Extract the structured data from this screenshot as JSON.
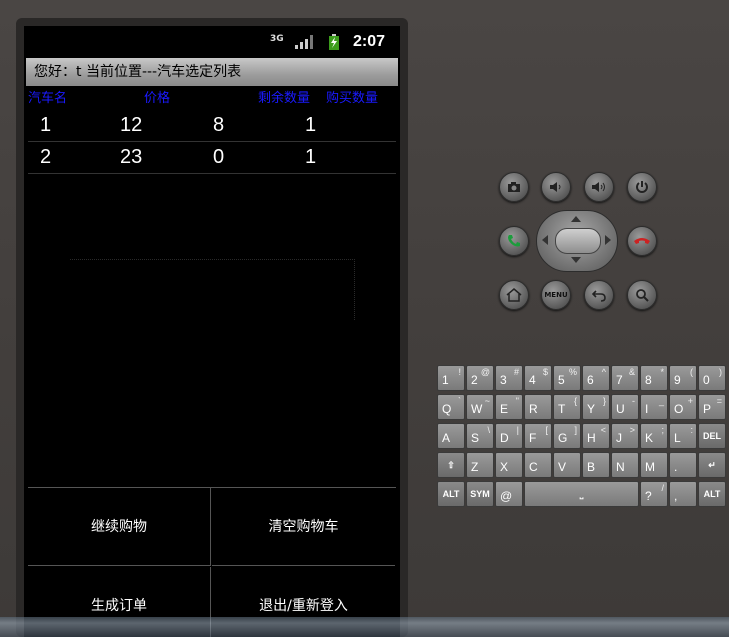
{
  "status": {
    "network": "3G",
    "time": "2:07"
  },
  "titlebar": {
    "text": "您好：t  当前位置---汽车选定列表"
  },
  "table": {
    "headers": [
      "汽车名",
      "价格",
      "剩余数量",
      "购买数量"
    ],
    "rows": [
      {
        "name": "1",
        "price": "12",
        "remaining": "8",
        "buy": "1"
      },
      {
        "name": "2",
        "price": "23",
        "remaining": "0",
        "buy": "1"
      }
    ]
  },
  "buttons": {
    "continue": "继续购物",
    "clear": "清空购物车",
    "order": "生成订单",
    "logout": "退出/重新登入"
  },
  "controls": {
    "menu_label": "MENU"
  },
  "keyboard": {
    "row1": [
      [
        "1",
        "!"
      ],
      [
        "2",
        "@"
      ],
      [
        "3",
        "#"
      ],
      [
        "4",
        "$"
      ],
      [
        "5",
        "%"
      ],
      [
        "6",
        "^"
      ],
      [
        "7",
        "&"
      ],
      [
        "8",
        "*"
      ],
      [
        "9",
        "("
      ],
      [
        "0",
        ")"
      ]
    ],
    "row2": [
      [
        "Q",
        "`"
      ],
      [
        "W",
        "~"
      ],
      [
        "E",
        "\""
      ],
      [
        "R",
        ""
      ],
      [
        "T",
        "{"
      ],
      [
        "Y",
        "}"
      ],
      [
        "U",
        "-"
      ],
      [
        "I",
        "_"
      ],
      [
        "O",
        "+"
      ],
      [
        "P",
        "="
      ]
    ],
    "row3": [
      [
        "A",
        ""
      ],
      [
        "S",
        "\\"
      ],
      [
        "D",
        "|"
      ],
      [
        "F",
        "["
      ],
      [
        "G",
        "]"
      ],
      [
        "H",
        "<"
      ],
      [
        "J",
        ">"
      ],
      [
        "K",
        ";"
      ],
      [
        "L",
        ":"
      ]
    ],
    "row4": [
      [
        "Z",
        ""
      ],
      [
        "X",
        ""
      ],
      [
        "C",
        ""
      ],
      [
        "V",
        ""
      ],
      [
        "B",
        ""
      ],
      [
        "N",
        ""
      ],
      [
        "M",
        ""
      ],
      [
        ".",
        ""
      ]
    ],
    "alt_left": "ALT",
    "sym": "SYM",
    "at": "@",
    "slash": "/",
    "question": "?",
    "comma": ",",
    "alt_right": "ALT",
    "del": "DEL"
  }
}
